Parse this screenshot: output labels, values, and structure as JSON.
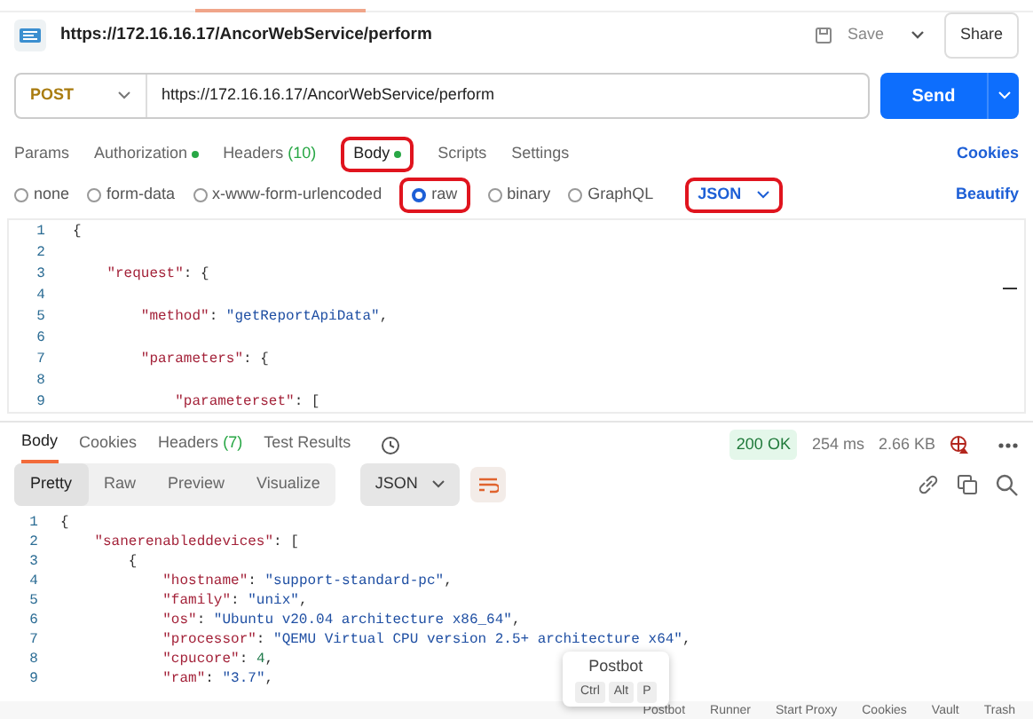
{
  "request_title": "https://172.16.16.17/AncorWebService/perform",
  "header_buttons": {
    "save": "Save",
    "share": "Share"
  },
  "url_bar": {
    "method": "POST",
    "url": "https://172.16.16.17/AncorWebService/perform",
    "send": "Send"
  },
  "request_tabs": [
    {
      "label": "Params",
      "selected": false,
      "dot": false,
      "annotated": false
    },
    {
      "label": "Authorization",
      "selected": false,
      "dot": true,
      "annotated": false
    },
    {
      "label": "Headers",
      "selected": false,
      "dot": false,
      "count": "(10)",
      "annotated": false
    },
    {
      "label": "Body",
      "selected": true,
      "dot": true,
      "annotated": true
    },
    {
      "label": "Scripts",
      "selected": false,
      "dot": false,
      "annotated": false
    },
    {
      "label": "Settings",
      "selected": false,
      "dot": false,
      "annotated": false
    }
  ],
  "cookies_link": "Cookies",
  "body_types": [
    {
      "label": "none",
      "selected": false,
      "annotated": false
    },
    {
      "label": "form-data",
      "selected": false,
      "annotated": false
    },
    {
      "label": "x-www-form-urlencoded",
      "selected": false,
      "annotated": false
    },
    {
      "label": "raw",
      "selected": true,
      "annotated": true
    },
    {
      "label": "binary",
      "selected": false,
      "annotated": false
    },
    {
      "label": "GraphQL",
      "selected": false,
      "annotated": false
    }
  ],
  "body_format": {
    "label": "JSON",
    "annotated": true
  },
  "beautify": "Beautify",
  "request_code": [
    {
      "number": "1",
      "text": "{"
    },
    {
      "number": "2"
    },
    {
      "number": "3",
      "text": "    \"request\": {"
    },
    {
      "number": "4"
    },
    {
      "number": "5",
      "text": "        \"method\": \"getReportApiData\","
    },
    {
      "number": "6"
    },
    {
      "number": "7",
      "text": "        \"parameters\": {"
    },
    {
      "number": "8"
    },
    {
      "number": "9",
      "text": "            \"parameterset\": ["
    }
  ],
  "response_tabs": [
    {
      "label": "Body",
      "selected": true
    },
    {
      "label": "Cookies",
      "selected": false
    },
    {
      "label": "Headers",
      "selected": false,
      "count": "(7)"
    },
    {
      "label": "Test Results",
      "selected": false
    }
  ],
  "response_meta": {
    "status": "200 OK",
    "time": "254 ms",
    "size": "2.66 KB"
  },
  "view_modes": [
    {
      "label": "Pretty",
      "selected": true
    },
    {
      "label": "Raw",
      "selected": false
    },
    {
      "label": "Preview",
      "selected": false
    },
    {
      "label": "Visualize",
      "selected": false
    }
  ],
  "response_format": "JSON",
  "response_code": [
    {
      "number": "1",
      "text": "{"
    },
    {
      "number": "2",
      "text": "    \"sanerenableddevices\": ["
    },
    {
      "number": "3",
      "text": "        {"
    },
    {
      "number": "4",
      "text": "            \"hostname\": \"support-standard-pc\","
    },
    {
      "number": "5",
      "text": "            \"family\": \"unix\","
    },
    {
      "number": "6",
      "text": "            \"os\": \"Ubuntu v20.04 architecture x86_64\","
    },
    {
      "number": "7",
      "text": "            \"processor\": \"QEMU Virtual CPU version 2.5+ architecture x64\","
    },
    {
      "number": "8",
      "text": "            \"cpucore\": 4,"
    },
    {
      "number": "9",
      "text": "            \"ram\": \"3.7\","
    }
  ],
  "tooltip": {
    "title": "Postbot",
    "keys": [
      "Ctrl",
      "Alt",
      "P"
    ]
  },
  "status_bar": [
    "Postbot",
    "Runner",
    "Start Proxy",
    "Cookies",
    "Vault",
    "Trash"
  ]
}
